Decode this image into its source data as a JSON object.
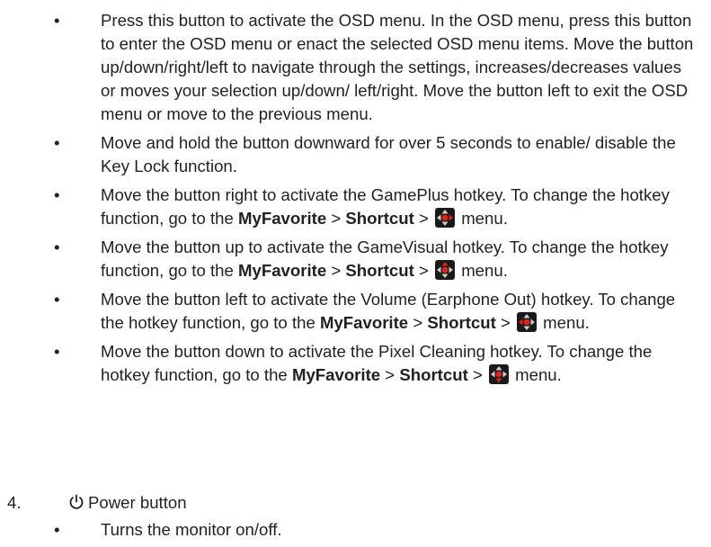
{
  "bullets": [
    {
      "text": "Press this button to activate the OSD menu. In the OSD menu, press this button to enter the OSD menu or enact the selected OSD menu items. Move the button up/down/right/left to navigate through the settings, increases/decreases values or moves your selection up/down/ left/right. Move the button left to exit the OSD menu or move to the previous menu."
    },
    {
      "text": "Move and hold the button downward for over 5 seconds to enable/ disable the Key Lock function."
    },
    {
      "prefix": "Move the button right to activate the GamePlus hotkey. To change the hotkey function, go to the",
      "menu1": "MyFavorite",
      "sep1": ">",
      "menu2": "Shortcut",
      "sep2": ">",
      "suffix": "menu.",
      "arrow": "right"
    },
    {
      "prefix": "Move the button up to activate the GameVisual hotkey. To change the hotkey function, go to the",
      "menu1": "MyFavorite",
      "sep1": ">",
      "menu2": "Shortcut",
      "sep2": ">",
      "suffix": "menu.",
      "arrow": "up"
    },
    {
      "prefix": "Move the button left to activate the Volume (Earphone Out) hotkey. To change the hotkey function, go to the",
      "menu1": "MyFavorite",
      "sep1": ">",
      "menu2": "Shortcut",
      "sep2": ">",
      "suffix": "menu.",
      "arrow": "left"
    },
    {
      "prefix": "Move the button down to activate the Pixel Cleaning hotkey. To change the hotkey function, go to the",
      "menu1": "MyFavorite",
      "sep1": ">",
      "menu2": "Shortcut",
      "sep2": ">",
      "suffix": "menu.",
      "arrow": "down"
    }
  ],
  "bullet_symbol": "•",
  "section": {
    "number": "4.",
    "icon": "power-icon",
    "title": "Power button"
  },
  "sub_bullets": [
    {
      "text": "Turns the monitor on/off."
    }
  ],
  "colors": {
    "text": "#231f20",
    "accent": "#e2231a",
    "icon_bg": "#1a1a1a"
  }
}
